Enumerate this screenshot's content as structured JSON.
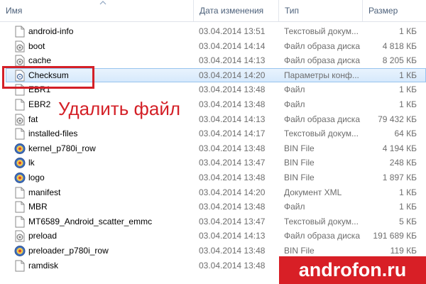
{
  "columns": {
    "name": "Имя",
    "date": "Дата изменения",
    "type": "Тип",
    "size": "Размер"
  },
  "icons": {
    "document": "document-icon",
    "disk_image": "disk-image-icon",
    "settings": "settings-file-icon",
    "bin": "bin-file-icon"
  },
  "files": [
    {
      "name": "android-info",
      "date": "03.04.2014 13:51",
      "type": "Текстовый докум...",
      "size": "1 КБ",
      "icon": "document"
    },
    {
      "name": "boot",
      "date": "03.04.2014 14:14",
      "type": "Файл образа диска",
      "size": "4 818 КБ",
      "icon": "disk_image"
    },
    {
      "name": "cache",
      "date": "03.04.2014 14:13",
      "type": "Файл образа диска",
      "size": "8 205 КБ",
      "icon": "disk_image"
    },
    {
      "name": "Checksum",
      "date": "03.04.2014 14:20",
      "type": "Параметры конф...",
      "size": "1 КБ",
      "icon": "settings"
    },
    {
      "name": "EBR1",
      "date": "03.04.2014 13:48",
      "type": "Файл",
      "size": "1 КБ",
      "icon": "document"
    },
    {
      "name": "EBR2",
      "date": "03.04.2014 13:48",
      "type": "Файл",
      "size": "1 КБ",
      "icon": "document"
    },
    {
      "name": "fat",
      "date": "03.04.2014 14:13",
      "type": "Файл образа диска",
      "size": "79 432 КБ",
      "icon": "disk_image"
    },
    {
      "name": "installed-files",
      "date": "03.04.2014 14:17",
      "type": "Текстовый докум...",
      "size": "64 КБ",
      "icon": "document"
    },
    {
      "name": "kernel_p780i_row",
      "date": "03.04.2014 13:48",
      "type": "BIN File",
      "size": "4 194 КБ",
      "icon": "bin"
    },
    {
      "name": "lk",
      "date": "03.04.2014 13:47",
      "type": "BIN File",
      "size": "248 КБ",
      "icon": "bin"
    },
    {
      "name": "logo",
      "date": "03.04.2014 13:48",
      "type": "BIN File",
      "size": "1 897 КБ",
      "icon": "bin"
    },
    {
      "name": "manifest",
      "date": "03.04.2014 14:20",
      "type": "Документ XML",
      "size": "1 КБ",
      "icon": "document"
    },
    {
      "name": "MBR",
      "date": "03.04.2014 13:48",
      "type": "Файл",
      "size": "1 КБ",
      "icon": "document"
    },
    {
      "name": "MT6589_Android_scatter_emmc",
      "date": "03.04.2014 13:47",
      "type": "Текстовый докум...",
      "size": "5 КБ",
      "icon": "document"
    },
    {
      "name": "preload",
      "date": "03.04.2014 14:13",
      "type": "Файл образа диска",
      "size": "191 689 КБ",
      "icon": "disk_image"
    },
    {
      "name": "preloader_p780i_row",
      "date": "03.04.2014 13:48",
      "type": "BIN File",
      "size": "119 КБ",
      "icon": "bin"
    },
    {
      "name": "ramdisk",
      "date": "03.04.2014 13:48",
      "type": "",
      "size": "",
      "icon": "document"
    }
  ],
  "selected_index": 3,
  "annotation": "Удалить файл",
  "watermark": "androfon.ru",
  "colors": {
    "accent_red": "#d42027",
    "selection_fill": "#d6e9fc",
    "selection_border": "#98c4ee",
    "header_text": "#4c607a"
  }
}
